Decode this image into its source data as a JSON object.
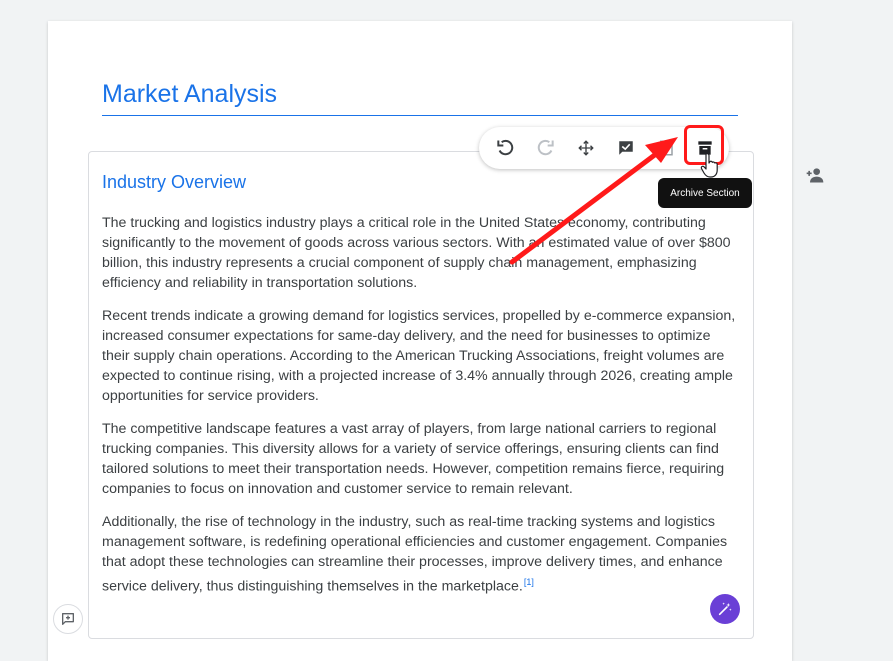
{
  "document": {
    "title": "Market Analysis"
  },
  "section": {
    "title": "Industry Overview",
    "paragraphs": [
      "The trucking and logistics industry plays a critical role in the United States economy, contributing significantly to the movement of goods across various sectors. With an estimated value of over $800 billion, this industry represents a crucial component of supply chain management, emphasizing efficiency and reliability in transportation solutions.",
      "Recent trends indicate a growing demand for logistics services, propelled by e-commerce expansion, increased consumer expectations for same-day delivery, and the need for businesses to optimize their supply chain operations. According to the American Trucking Associations, freight volumes are expected to continue rising, with a projected increase of 3.4% annually through 2026, creating ample opportunities for service providers.",
      "The competitive landscape features a vast array of players, from large national carriers to regional trucking companies. This diversity allows for a variety of service offerings, ensuring clients can find tailored solutions to meet their transportation needs. However, competition remains fierce, requiring companies to focus on innovation and customer service to remain relevant.",
      "Additionally, the rise of technology in the industry, such as real-time tracking systems and logistics management software, is redefining operational efficiencies and customer engagement. Companies that adopt these technologies can streamline their processes, improve delivery times, and enhance service delivery, thus distinguishing themselves in the marketplace."
    ],
    "footnote": "[1]"
  },
  "toolbar": {
    "tooltip": "Archive Section",
    "icons": [
      "undo-icon",
      "redo-icon",
      "move-icon",
      "approve-icon",
      "copy-icon",
      "archive-icon"
    ]
  },
  "colors": {
    "accent": "#1a73e8",
    "highlight": "#ff1a1a",
    "magic": "#6a3fd6"
  }
}
